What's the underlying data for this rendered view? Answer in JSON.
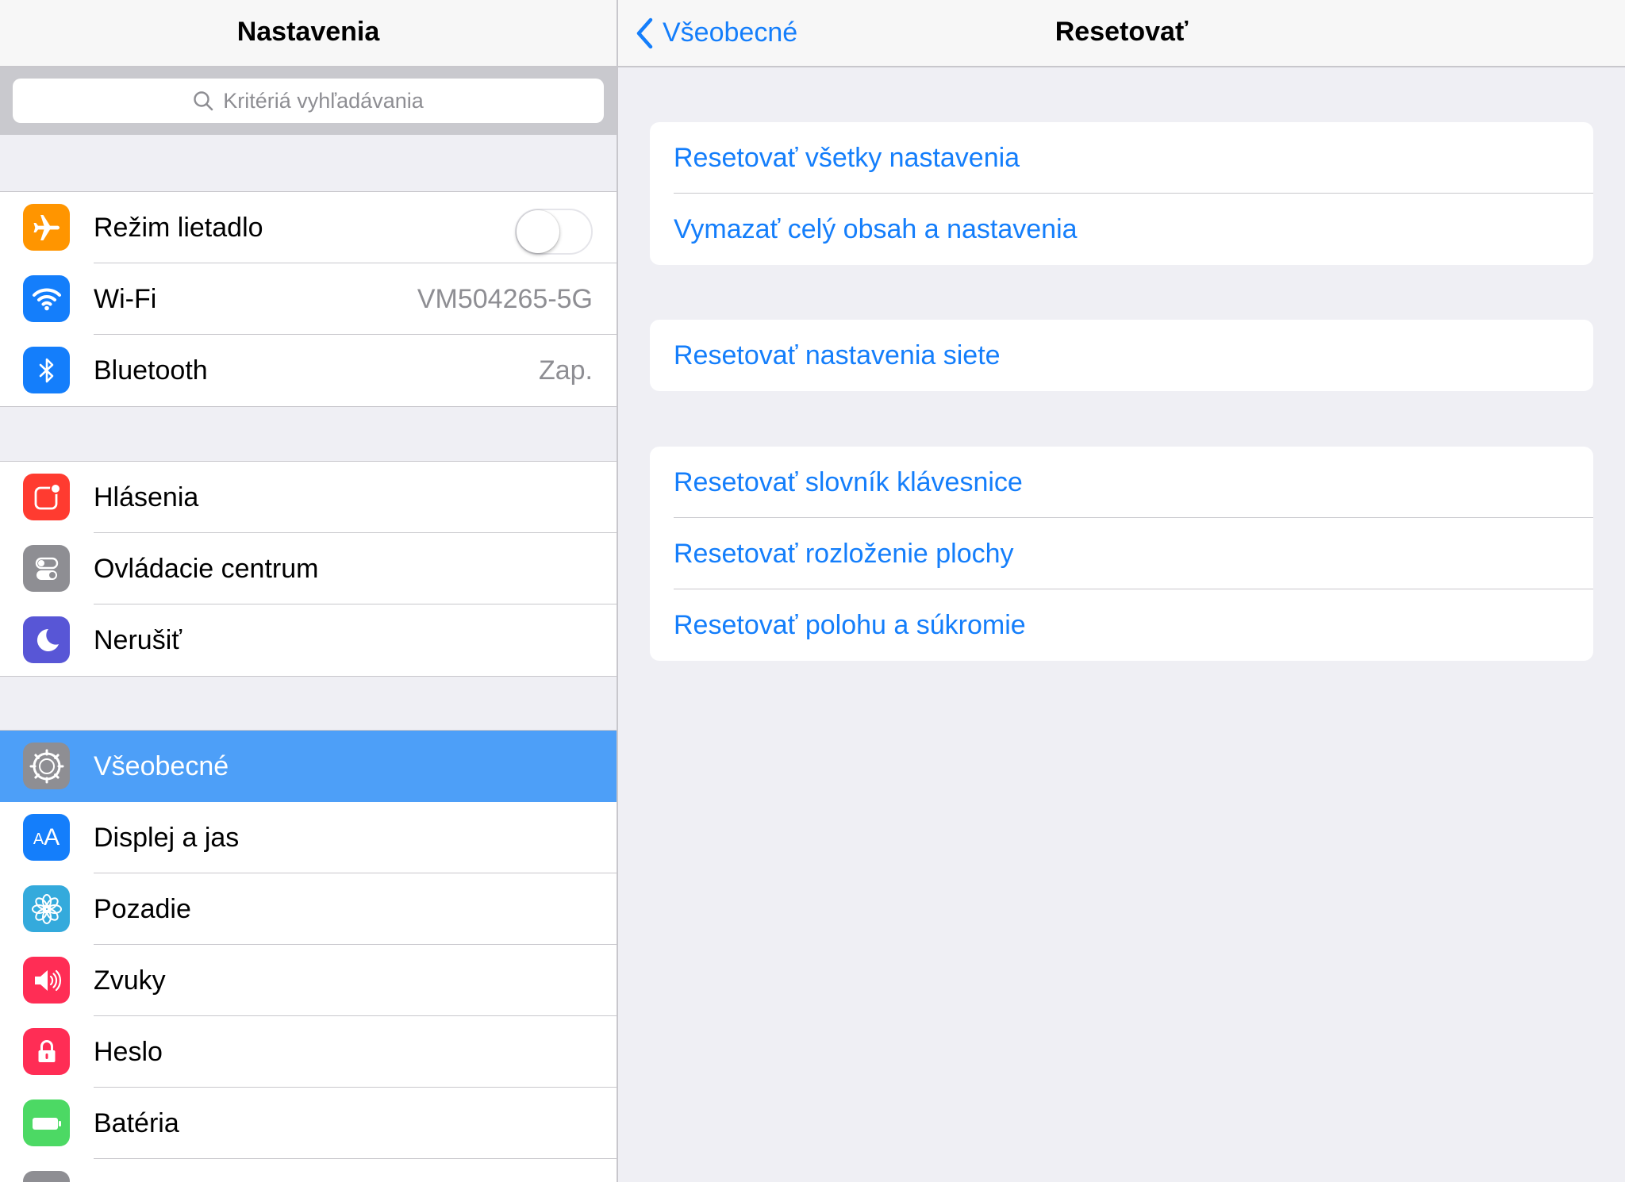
{
  "left": {
    "title": "Nastavenia",
    "search_placeholder": "Kritériá vyhľadávania",
    "groups": [
      [
        {
          "label": "Režim lietadlo",
          "icon": "airplane-icon",
          "color": "#ff9500",
          "toggle_on": false
        },
        {
          "label": "Wi-Fi",
          "icon": "wifi-icon",
          "color": "#147efb",
          "value": "VM504265-5G"
        },
        {
          "label": "Bluetooth",
          "icon": "bluetooth-icon",
          "color": "#147efb",
          "value": "Zap."
        }
      ],
      [
        {
          "label": "Hlásenia",
          "icon": "notifications-icon",
          "color": "#ff3b30"
        },
        {
          "label": "Ovládacie centrum",
          "icon": "control-center-icon",
          "color": "#8e8e93"
        },
        {
          "label": "Nerušiť",
          "icon": "moon-icon",
          "color": "#5856d6"
        }
      ],
      [
        {
          "label": "Všeobecné",
          "icon": "gear-icon",
          "color": "#8e8e93",
          "selected": true
        },
        {
          "label": "Displej a jas",
          "icon": "text-size-icon",
          "color": "#147efb"
        },
        {
          "label": "Pozadie",
          "icon": "wallpaper-flower-icon",
          "color": "#34aadc"
        },
        {
          "label": "Zvuky",
          "icon": "speaker-icon",
          "color": "#ff2d55"
        },
        {
          "label": "Heslo",
          "icon": "lock-icon",
          "color": "#ff2d55"
        },
        {
          "label": "Batéria",
          "icon": "battery-icon",
          "color": "#4cd964"
        }
      ]
    ]
  },
  "right": {
    "back_label": "Všeobecné",
    "title": "Resetovať",
    "groups": [
      [
        "Resetovať všetky nastavenia",
        "Vymazať celý obsah a nastavenia"
      ],
      [
        "Resetovať nastavenia siete"
      ],
      [
        "Resetovať slovník klávesnice",
        "Resetovať rozloženie plochy",
        "Resetovať polohu a súkromie"
      ]
    ]
  },
  "colors": {
    "accent": "#147efb",
    "selected_row": "#4d9ff8",
    "background": "#efeff4"
  }
}
